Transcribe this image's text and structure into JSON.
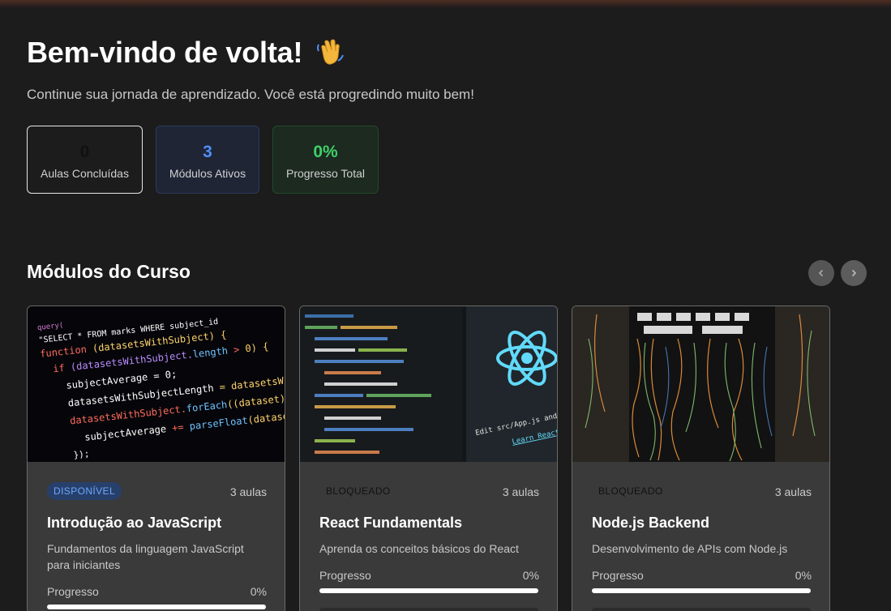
{
  "header": {
    "title": "Bem-vindo de volta!",
    "wave_icon": "waving-hand-icon",
    "subtitle": "Continue sua jornada de aprendizado. Você está progredindo muito bem!"
  },
  "stats": [
    {
      "value": "0",
      "label": "Aulas Concluídas",
      "color": "#111111"
    },
    {
      "value": "3",
      "label": "Módulos Ativos",
      "color": "#4f8ef7"
    },
    {
      "value": "0%",
      "label": "Progresso Total",
      "color": "#3fd06a"
    }
  ],
  "modules_section": {
    "title": "Módulos do Curso",
    "prev_icon": "chevron-left-icon",
    "next_icon": "chevron-right-icon"
  },
  "modules": [
    {
      "status": "DISPONÍVEL",
      "lessons": "3 aulas",
      "title": "Introdução ao JavaScript",
      "description": "Fundamentos da linguagem JavaScript para iniciantes",
      "progress_label": "Progresso",
      "progress_text": "0%",
      "progress": 0
    },
    {
      "status": "BLOQUEADO",
      "lessons": "3 aulas",
      "title": "React Fundamentals",
      "description": "Aprenda os conceitos básicos do React",
      "progress_label": "Progresso",
      "progress_text": "0%",
      "progress": 0
    },
    {
      "status": "BLOQUEADO",
      "lessons": "3 aulas",
      "title": "Node.js Backend",
      "description": "Desenvolvimento de APIs com Node.js",
      "progress_label": "Progresso",
      "progress_text": "0%",
      "progress": 0
    }
  ]
}
